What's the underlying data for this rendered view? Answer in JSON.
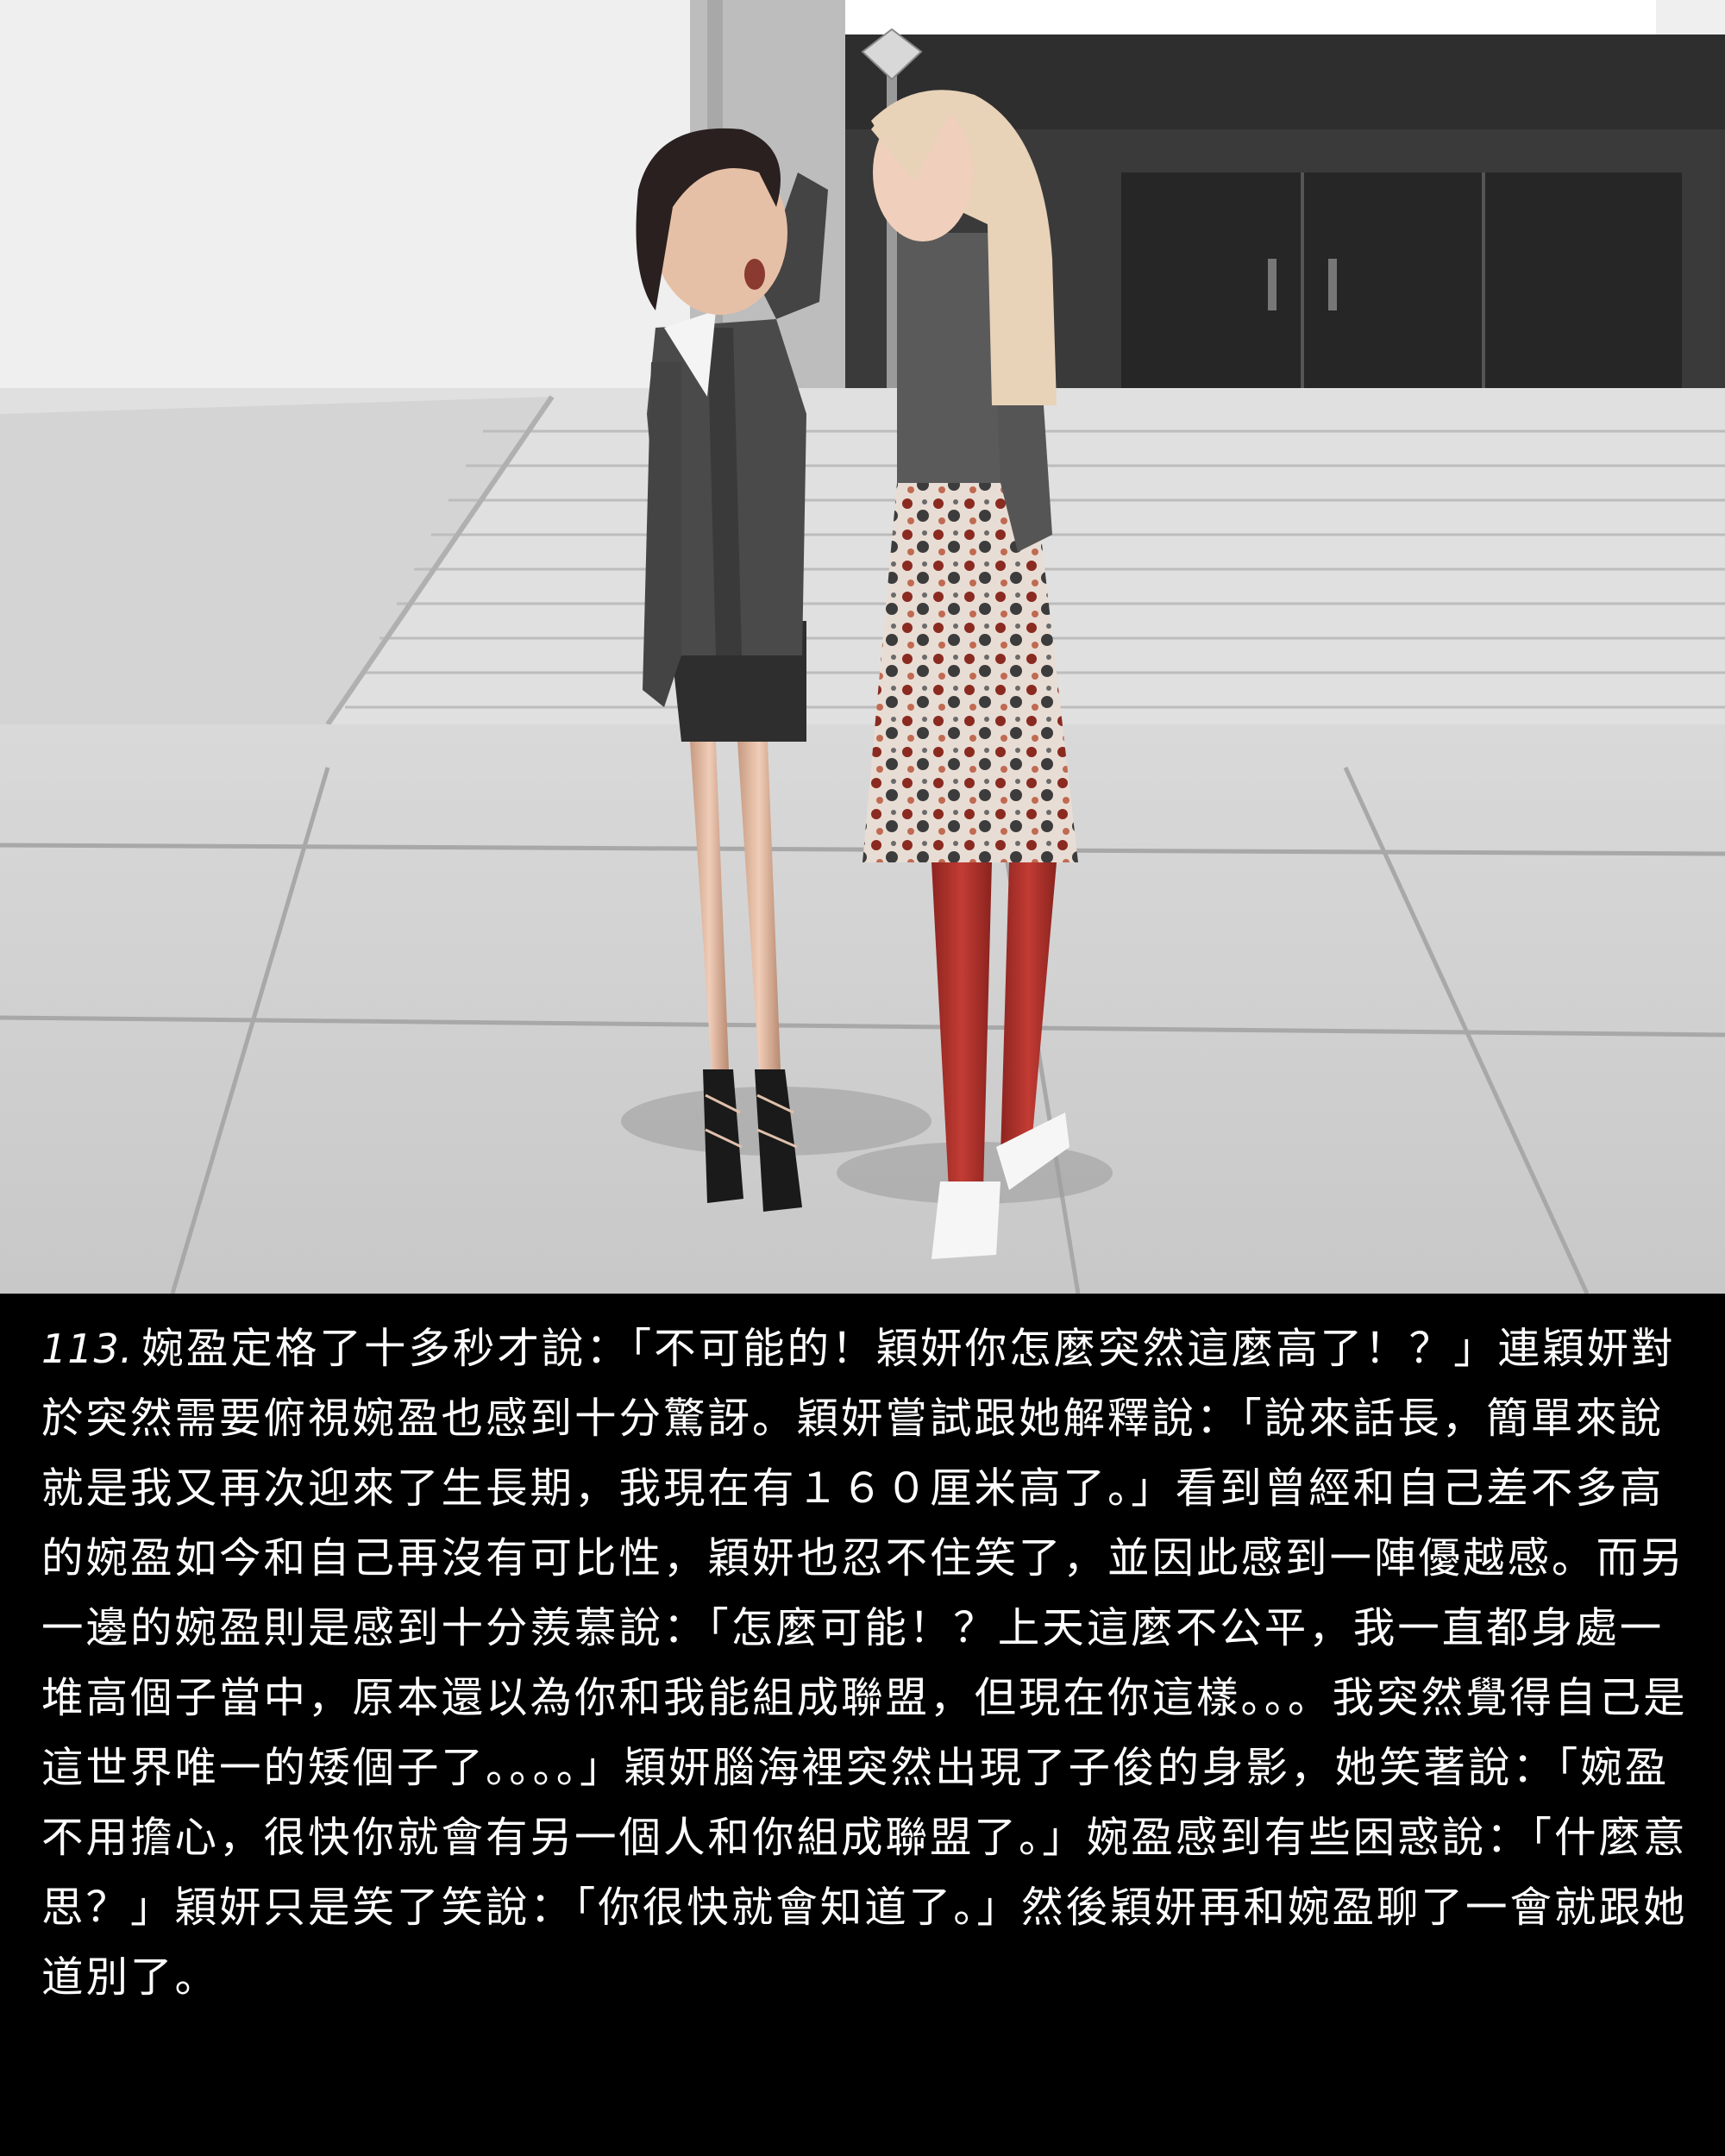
{
  "panel": {
    "number": "113.",
    "text": "婉盈定格了十多秒才說：「不可能的！穎妍你怎麼突然這麼高了！？」連穎妍對於突然需要俯視婉盈也感到十分驚訝。穎妍嘗試跟她解釋說：「說來話長，簡單來說就是我又再次迎來了生長期，我現在有１６０厘米高了。」看到曾經和自己差不多高的婉盈如今和自己再沒有可比性，穎妍也忍不住笑了，並因此感到一陣優越感。而另一邊的婉盈則是感到十分羨慕說：「怎麼可能！？上天這麼不公平，我一直都身處一堆高個子當中，原本還以為你和我能組成聯盟，但現在你這樣。。。我突然覺得自己是這世界唯一的矮個子了。。。。」穎妍腦海裡突然出現了子俊的身影，她笑著說：「婉盈不用擔心，很快你就會有另一個人和你組成聯盟了。」婉盈感到有些困惑說：「什麼意思？」穎妍只是笑了笑說：「你很快就會知道了。」然後穎妍再和婉盈聊了一會就跟她道別了。"
  },
  "colors": {
    "caption_background": "#000000",
    "caption_text": "#ffffff",
    "red_stockings": "#b8322c",
    "sweater": "#5a5a5a",
    "suit": "#4a4a4a",
    "blonde_hair": "#e8d2b8"
  }
}
